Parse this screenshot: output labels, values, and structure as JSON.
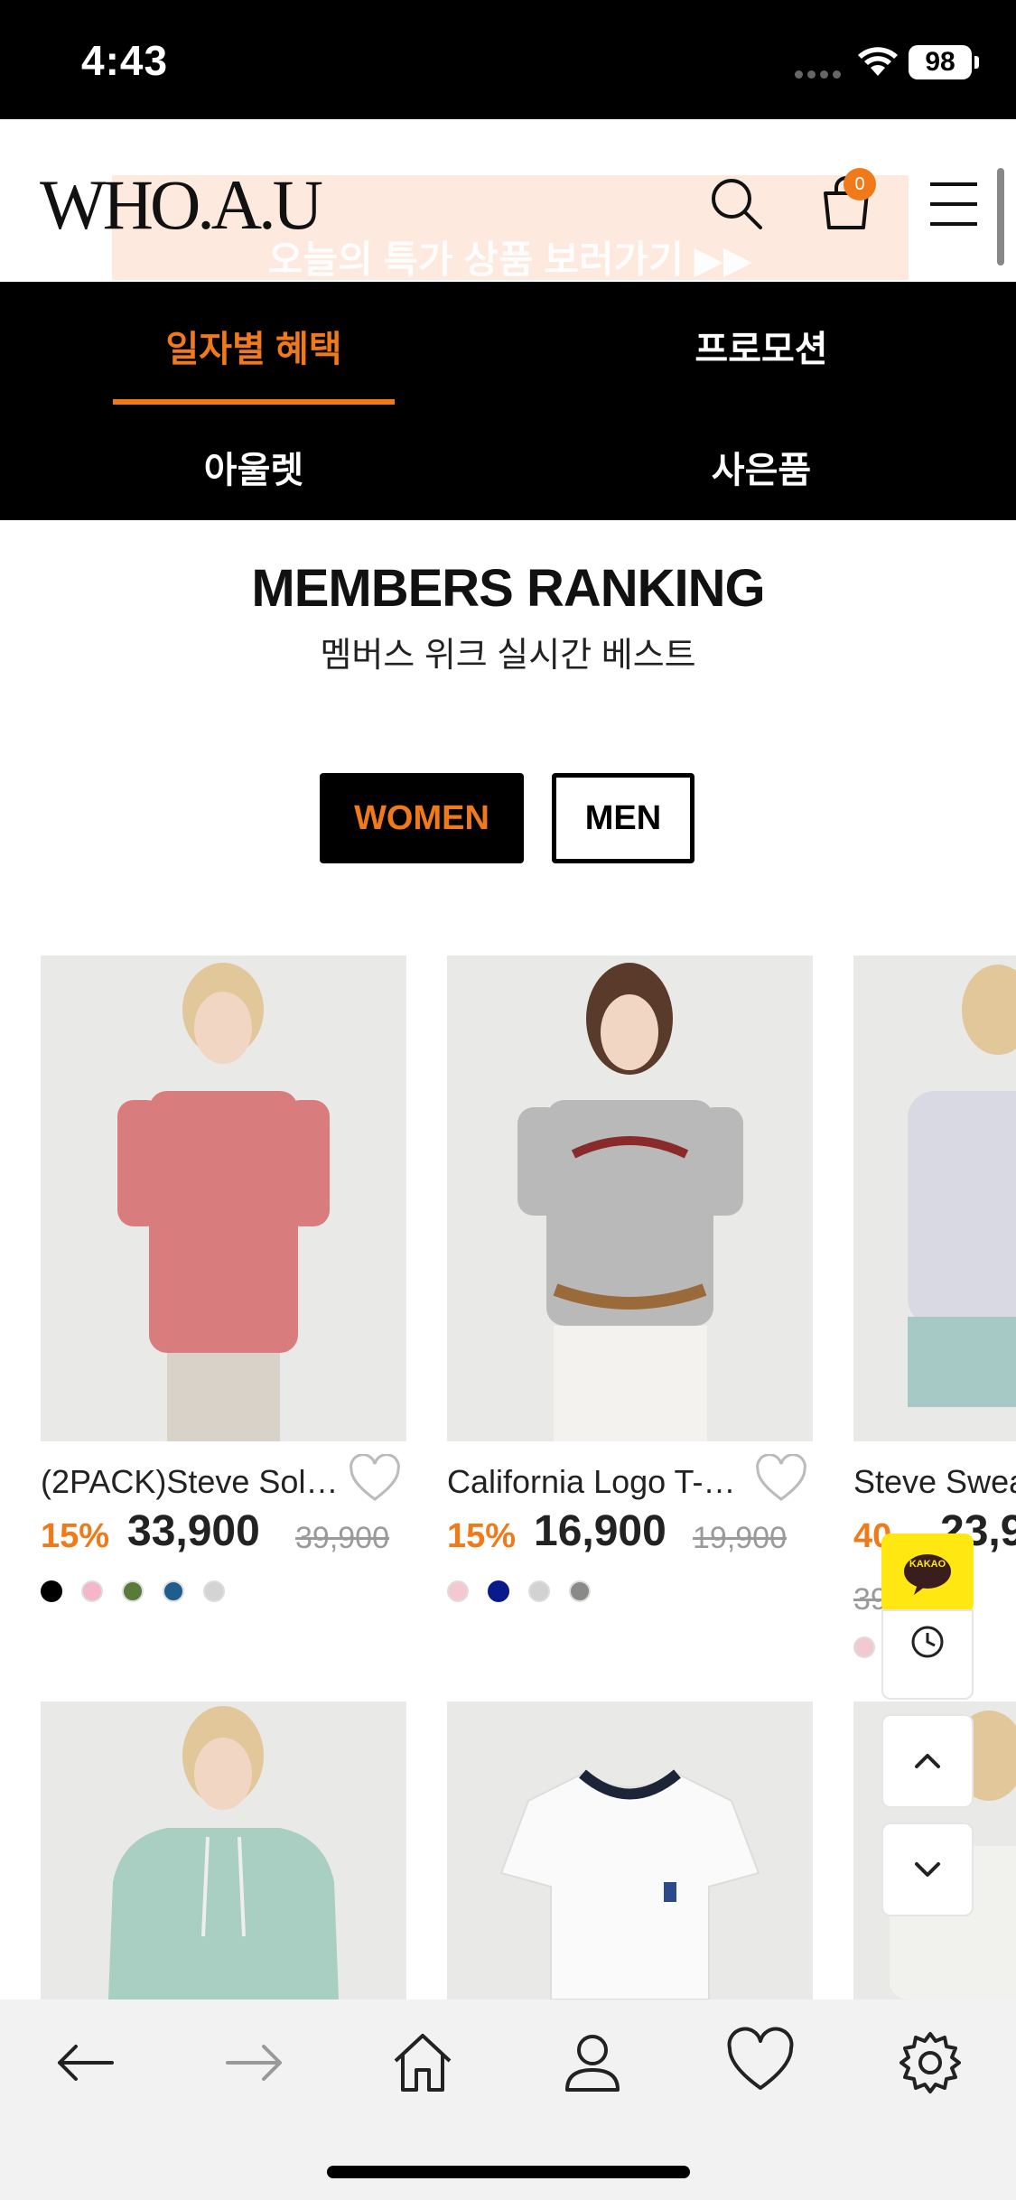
{
  "status_bar": {
    "time": "4:43",
    "battery": "98"
  },
  "header": {
    "logo": "WHO.A.U",
    "promo_text": "오늘의 특가 상품 보러가기 ▶▶",
    "cart_count": "0"
  },
  "nav": {
    "items": [
      {
        "label": "일자별 혜택",
        "active": true
      },
      {
        "label": "프로모션",
        "active": false
      },
      {
        "label": "아울렛",
        "active": false
      },
      {
        "label": "사은품",
        "active": false
      }
    ]
  },
  "ranking": {
    "title": "MEMBERS RANKING",
    "subtitle": "멤버스 위크 실시간 베스트",
    "tabs": {
      "women": "WOMEN",
      "men": "MEN"
    }
  },
  "products": [
    {
      "name": "(2PACK)Steve Soli…",
      "discount": "15%",
      "price": "33,900",
      "original": "39,900",
      "swatches": [
        "#000000",
        "#f4b6c8",
        "#5a7a3a",
        "#1f5e8c",
        "#d4d4d4"
      ]
    },
    {
      "name": "California Logo T-s…",
      "discount": "15%",
      "price": "16,900",
      "original": "19,900",
      "swatches": [
        "#f3c9cf",
        "#0b1a8a",
        "#d2d2d2",
        "#8a8a88"
      ]
    },
    {
      "name": "Steve Swea",
      "discount": "40",
      "price": "23,9",
      "original": "39",
      "swatches": [
        "#f3c9cf",
        "#0b1a8a"
      ]
    }
  ],
  "floating": {
    "kakao": "KAKAO"
  },
  "colors": {
    "accent": "#f07a1a",
    "black": "#000000"
  }
}
